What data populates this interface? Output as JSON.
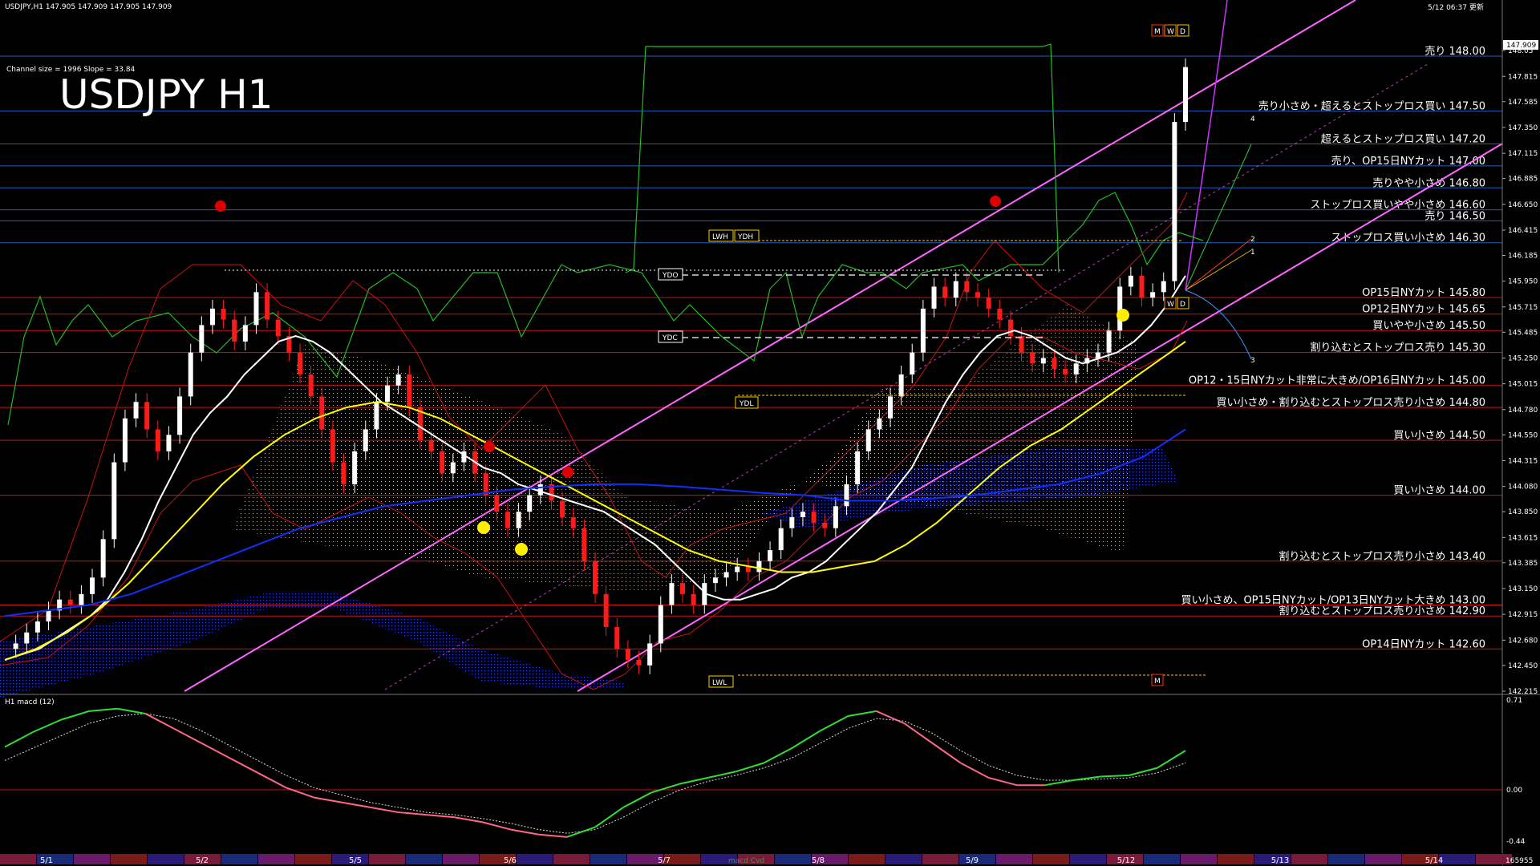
{
  "header": {
    "info_line": "USDJPY,H1  147.905 147.909 147.905 147.909",
    "timestamp": "5/12 06:37 更新"
  },
  "main": {
    "title": "USDJPY H1",
    "channel_info": "Channel size = 1996 Slope = 33.84",
    "current_price_tag": "147.909"
  },
  "markers": {
    "ydo": "YDO",
    "ydc": "YDC",
    "ydl": "YDL",
    "lwh": "LWH",
    "ydh": "YDH",
    "lwl": "LWL",
    "mwd": [
      "M",
      "W",
      "D"
    ],
    "wd": [
      "W",
      "D"
    ],
    "m_bottom": "M",
    "fan_labels": [
      "4",
      "2",
      "1",
      "3"
    ]
  },
  "colors": {
    "background": "#000000",
    "blue_level": "#1f5fbf",
    "red_level": "#c81414",
    "channel": "#ff66ff",
    "bull_candle": "#ffffff",
    "bear_candle": "#ff1a1a",
    "ma_white": "#ffffff",
    "ma_yellow": "#ffff00",
    "ma_blue": "#1030ff",
    "macd_up": "#33dd33",
    "macd_down": "#ff6688",
    "signal": "#dddddd"
  },
  "subwindow": {
    "label": "H1  macd (12)",
    "ticks": [
      "0.71",
      "0.00",
      "-0.44"
    ],
    "corner": "165955",
    "watermark": "macd Cvd"
  },
  "chart_data": {
    "type": "line",
    "title": "USDJPY H1",
    "ylim": [
      142.215,
      148.27
    ],
    "y_ticks": [
      "148.05",
      "147.815",
      "147.585",
      "147.350",
      "147.115",
      "146.885",
      "146.650",
      "146.415",
      "146.185",
      "145.950",
      "145.715",
      "145.485",
      "145.250",
      "145.015",
      "144.780",
      "144.550",
      "144.315",
      "144.080",
      "143.850",
      "143.615",
      "143.385",
      "143.150",
      "142.915",
      "142.680",
      "142.450",
      "142.215"
    ],
    "x_dates": [
      "5/1",
      "5/2",
      "5/5",
      "5/6",
      "5/7",
      "5/8",
      "5/9",
      "5/12",
      "5/13",
      "5/14"
    ],
    "levels": [
      {
        "price": 148.0,
        "label": "売り 148.00",
        "color": "blue"
      },
      {
        "price": 147.5,
        "label": "売り小さめ・超えるとストップロス買い 147.50",
        "color": "blue"
      },
      {
        "price": 147.2,
        "label": "超えるとストップロス買い 147.20",
        "color": "blue"
      },
      {
        "price": 147.0,
        "label": "売り、OP15日NYカット 147.00",
        "color": "blue"
      },
      {
        "price": 146.8,
        "label": "売りやや小さめ 146.80",
        "color": "blue"
      },
      {
        "price": 146.6,
        "label": "ストップロス買いやや小さめ 146.60",
        "color": "blue"
      },
      {
        "price": 146.5,
        "label": "売り 146.50",
        "color": "blue"
      },
      {
        "price": 146.3,
        "label": "ストップロス買い小さめ 146.30",
        "color": "blue"
      },
      {
        "price": 145.8,
        "label": "OP15日NYカット 145.80",
        "color": "red"
      },
      {
        "price": 145.65,
        "label": "OP12日NYカット 145.65",
        "color": "red"
      },
      {
        "price": 145.5,
        "label": "買いやや小さめ 145.50",
        "color": "red"
      },
      {
        "price": 145.3,
        "label": "割り込むとストップロス売り 145.30",
        "color": "red"
      },
      {
        "price": 145.0,
        "label": "OP12・15日NYカット非常に大きめ/OP16日NYカット 145.00",
        "color": "red"
      },
      {
        "price": 144.8,
        "label": "買い小さめ・割り込むとストップロス売り小さめ 144.80",
        "color": "red"
      },
      {
        "price": 144.5,
        "label": "買い小さめ 144.50",
        "color": "red"
      },
      {
        "price": 144.0,
        "label": "買い小さめ 144.00",
        "color": "red"
      },
      {
        "price": 143.4,
        "label": "割り込むとストップロス売り小さめ 143.40",
        "color": "red"
      },
      {
        "price": 143.0,
        "label": "買い小さめ、OP15日NYカット/OP13日NYカット大きめ 143.00",
        "color": "red"
      },
      {
        "price": 142.9,
        "label": "割り込むとストップロス売り小さめ 142.90",
        "color": "red"
      },
      {
        "price": 142.6,
        "label": "OP14日NYカット 142.60",
        "color": "red"
      }
    ],
    "series": [
      {
        "values": [
          142.6,
          142.65,
          142.75,
          142.85,
          142.95,
          143.05,
          143.0,
          143.1,
          143.25,
          143.6,
          144.3,
          144.7,
          144.85,
          144.6,
          144.4,
          144.55,
          144.9,
          145.3,
          145.55,
          145.7,
          145.6,
          145.4,
          145.55,
          145.85,
          145.6,
          145.45,
          145.3,
          145.1,
          144.9,
          144.6,
          144.3,
          144.1,
          144.4,
          144.6,
          144.85,
          145.0,
          145.1,
          144.8,
          144.5,
          144.4,
          144.2,
          144.3,
          144.4,
          144.2,
          144.0,
          143.85,
          143.7,
          143.85,
          144.0,
          144.1,
          143.95,
          143.8,
          143.7,
          143.4,
          143.1,
          142.8,
          142.6,
          142.5,
          142.45,
          142.65,
          143.0,
          143.2,
          143.1,
          143.0,
          143.2,
          143.25,
          143.3,
          143.35,
          143.3,
          143.4,
          143.5,
          143.7,
          143.8,
          143.85,
          143.75,
          143.7,
          143.9,
          144.1,
          144.4,
          144.6,
          144.7,
          144.9,
          145.1,
          145.3,
          145.7,
          145.9,
          145.8,
          145.95,
          145.85,
          145.8,
          145.7,
          145.6,
          145.45,
          145.3,
          145.2,
          145.25,
          145.15,
          145.1,
          145.2,
          145.25,
          145.3,
          145.5,
          145.9,
          146.0,
          145.8,
          145.85,
          145.95,
          147.4,
          147.9
        ]
      },
      {
        "values": [
          142.5,
          142.55,
          142.6,
          142.7,
          142.8,
          142.9,
          143.05,
          143.3,
          143.6,
          143.95,
          144.25,
          144.55,
          144.75,
          144.9,
          145.1,
          145.25,
          145.4,
          145.45,
          145.4,
          145.3,
          145.15,
          145.0,
          144.85,
          144.75,
          144.65,
          144.55,
          144.45,
          144.35,
          144.25,
          144.2,
          144.1,
          144.05,
          144.0,
          143.95,
          143.9,
          143.85,
          143.75,
          143.65,
          143.55,
          143.4,
          143.25,
          143.1,
          143.05,
          143.05,
          143.1,
          143.15,
          143.25,
          143.3,
          143.4,
          143.55,
          143.7,
          143.85,
          144.05,
          144.25,
          144.55,
          144.85,
          145.1,
          145.3,
          145.45,
          145.5,
          145.45,
          145.35,
          145.25,
          145.2,
          145.25,
          145.3,
          145.4,
          145.55,
          145.75,
          146.0
        ]
      },
      {
        "values": [
          142.5,
          142.6,
          142.75,
          142.95,
          143.2,
          143.5,
          143.8,
          144.1,
          144.35,
          144.55,
          144.7,
          144.8,
          144.85,
          144.8,
          144.7,
          144.55,
          144.4,
          144.25,
          144.1,
          143.95,
          143.8,
          143.65,
          143.5,
          143.4,
          143.35,
          143.3,
          143.3,
          143.35,
          143.4,
          143.55,
          143.75,
          144.0,
          144.25,
          144.45,
          144.6,
          144.8,
          145.0,
          145.2,
          145.4
        ]
      },
      {
        "values": [
          142.9,
          142.95,
          143.0,
          143.1,
          143.25,
          143.4,
          143.55,
          143.7,
          143.8,
          143.9,
          143.95,
          144.0,
          144.05,
          144.08,
          144.1,
          144.1,
          144.08,
          144.05,
          144.02,
          144.0,
          143.95,
          143.95,
          143.97,
          144.0,
          144.05,
          144.1,
          144.2,
          144.35,
          144.6
        ]
      }
    ],
    "macd": {
      "ylim": [
        -0.44,
        0.71
      ],
      "macd_values": [
        0.33,
        0.45,
        0.55,
        0.62,
        0.64,
        0.6,
        0.48,
        0.36,
        0.24,
        0.12,
        0.0,
        -0.08,
        -0.12,
        -0.16,
        -0.2,
        -0.22,
        -0.24,
        -0.28,
        -0.34,
        -0.38,
        -0.4,
        -0.32,
        -0.16,
        -0.04,
        0.03,
        0.08,
        0.13,
        0.2,
        0.32,
        0.46,
        0.58,
        0.62,
        0.52,
        0.36,
        0.2,
        0.08,
        0.02,
        0.02,
        0.06,
        0.09,
        0.1,
        0.16,
        0.3
      ],
      "signal_values": [
        0.22,
        0.32,
        0.42,
        0.52,
        0.58,
        0.6,
        0.56,
        0.46,
        0.34,
        0.22,
        0.1,
        0.0,
        -0.06,
        -0.12,
        -0.16,
        -0.2,
        -0.22,
        -0.25,
        -0.29,
        -0.34,
        -0.37,
        -0.34,
        -0.24,
        -0.12,
        -0.02,
        0.05,
        0.1,
        0.16,
        0.24,
        0.36,
        0.48,
        0.56,
        0.54,
        0.44,
        0.3,
        0.18,
        0.1,
        0.06,
        0.06,
        0.07,
        0.08,
        0.12,
        0.2
      ]
    }
  }
}
